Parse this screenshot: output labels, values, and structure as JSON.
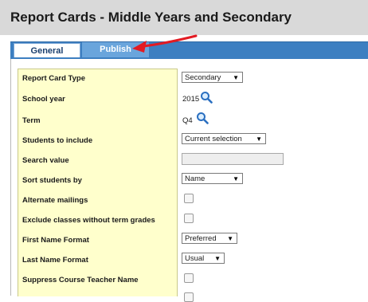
{
  "page": {
    "title": "Report Cards - Middle Years and Secondary"
  },
  "tabs": [
    {
      "label": "General",
      "active": true
    },
    {
      "label": "Publish",
      "active": false
    }
  ],
  "colors": {
    "tab_strip": "#3d7fc1",
    "label_column": "#ffffcc",
    "annotation_arrow": "#e31b23"
  },
  "annotation": {
    "icon": "red-arrow",
    "points_to": "Publish tab"
  },
  "form": {
    "report_card_type": {
      "label": "Report Card Type",
      "value": "Secondary"
    },
    "school_year": {
      "label": "School year",
      "value": "2015",
      "icon": "magnifier-icon"
    },
    "term": {
      "label": "Term",
      "value": "Q4",
      "icon": "magnifier-icon"
    },
    "students_to_include": {
      "label": "Students to include",
      "value": "Current selection"
    },
    "search_value": {
      "label": "Search value",
      "value": ""
    },
    "sort_students_by": {
      "label": "Sort students by",
      "value": "Name"
    },
    "alternate_mailings": {
      "label": "Alternate mailings",
      "checked": false
    },
    "exclude_classes": {
      "label": "Exclude classes without term grades",
      "checked": false
    },
    "first_name_format": {
      "label": "First Name Format",
      "value": "Preferred"
    },
    "last_name_format": {
      "label": "Last Name Format",
      "value": "Usual"
    },
    "suppress_teacher": {
      "label": "Suppress Course Teacher Name",
      "checked": false
    }
  }
}
